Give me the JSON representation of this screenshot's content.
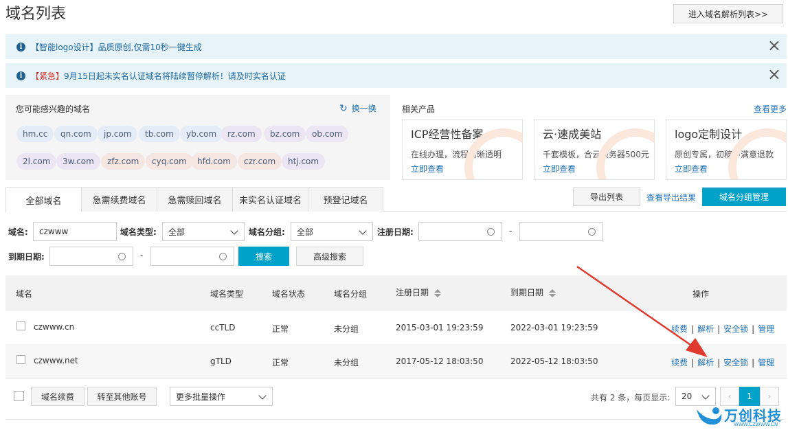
{
  "header": {
    "title": "域名列表",
    "dns_list_button": "进入域名解析列表>>"
  },
  "notices": [
    {
      "tag": "【智能logo设计】",
      "text": "品质原创,仅需10秒一键生成",
      "tag_color": "#1f67a0"
    },
    {
      "tag": "【紧急】",
      "text": "9月15日起未实名认证域名将陆续暂停解析！请及时实名认证",
      "tag_color": "#d9352a"
    }
  ],
  "suggest": {
    "title": "您可能感兴趣的域名",
    "refresh": "换一换",
    "row1": [
      "hm.cc",
      "qn.com",
      "jp.com",
      "tb.com",
      "yb.com",
      "rz.com",
      "bz.com",
      "ob.com"
    ],
    "row2": [
      "2l.com",
      "3w.com",
      "zfz.com",
      "cyq.com",
      "hfd.com",
      "czr.com",
      "htj.com"
    ]
  },
  "products": {
    "title": "相关产品",
    "more": "查看更多",
    "cards": [
      {
        "title": "ICP经营性备案",
        "desc": "在线办理，流程清晰透明",
        "link": "立即查看"
      },
      {
        "title": "云·速成美站",
        "desc": "千套模板，合云服务器500元",
        "link": "立即查看"
      },
      {
        "title": "logo定制设计",
        "desc": "原创专属，初稿不满意退款",
        "link": "立即查看"
      }
    ]
  },
  "tabs": [
    "全部域名",
    "急需续费域名",
    "急需赎回域名",
    "未实名认证域名",
    "预登记域名"
  ],
  "actions": {
    "export": "导出列表",
    "view_export": "查看导出结果",
    "group_manage": "域名分组管理"
  },
  "filters": {
    "domain_label": "域名:",
    "domain_value": "czwww",
    "type_label": "域名类型:",
    "type_value": "全部",
    "group_label": "域名分组:",
    "group_value": "全部",
    "reg_label": "注册日期:",
    "dash": "-",
    "exp_label": "到期日期:",
    "search": "搜索",
    "advanced": "高级搜索"
  },
  "table": {
    "headers": [
      "域名",
      "域名类型",
      "域名状态",
      "域名分组",
      "注册日期",
      "到期日期",
      "操作"
    ],
    "rows": [
      {
        "domain": "czwww.cn",
        "type": "ccTLD",
        "status": "正常",
        "group": "未分组",
        "reg": "2015-03-01 19:23:59",
        "exp": "2022-03-01 19:23:59"
      },
      {
        "domain": "czwww.net",
        "type": "gTLD",
        "status": "正常",
        "group": "未分组",
        "reg": "2017-05-12 18:03:50",
        "exp": "2022-05-12 18:03:50"
      }
    ],
    "ops": [
      "续费",
      "解析",
      "安全锁",
      "管理"
    ]
  },
  "footer": {
    "renew": "域名续费",
    "transfer": "转至其他账号",
    "batch": "更多批量操作",
    "total": "共有 2 条，每页显示:",
    "page_size": "20",
    "page": "1"
  },
  "watermark": {
    "brand": "万创科技",
    "url": "WWW.CZWWW.CN"
  },
  "colors": {
    "accent": "#00a2ca",
    "link": "#1f72b8",
    "arrow": "#e03a2f"
  }
}
